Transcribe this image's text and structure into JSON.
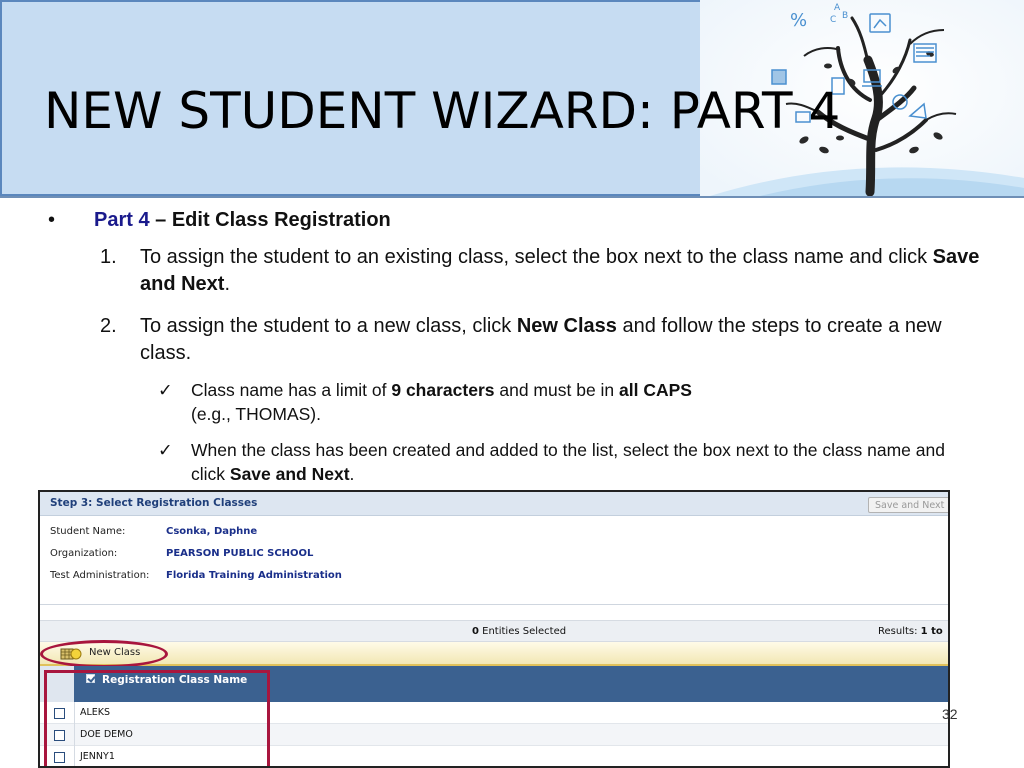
{
  "slide": {
    "title": "NEW STUDENT WIZARD: PART 4",
    "page_number": "32",
    "bullet": {
      "marker": "•",
      "part": "Part 4",
      "rest": " – Edit Class Registration"
    },
    "items": [
      {
        "num": "1.",
        "pre": "To assign the student to an existing class, select the box next to the class name and click ",
        "bold": "Save and Next",
        "post": "."
      },
      {
        "num": "2.",
        "pre": "To assign the student to a new class, click ",
        "bold": "New Class",
        "post": " and follow the steps to create a new class."
      }
    ],
    "checks": [
      {
        "mark": "✓",
        "p1": "Class name has a limit of ",
        "b1": "9 characters",
        "p2": " and must be in ",
        "b2": "all CAPS",
        "p3": " (e.g., THOMAS)."
      },
      {
        "mark": "✓",
        "p1": "When the class has been created and added to the list, select the box next to the class name and click ",
        "b1": "Save and Next",
        "p2": "."
      }
    ]
  },
  "app": {
    "step_title": "Step 3: Select Registration Classes",
    "save_next_label": "Save and Next",
    "fields": [
      {
        "label": "Student Name:",
        "value": "Csonka,  Daphne"
      },
      {
        "label": "Organization:",
        "value": "PEARSON PUBLIC SCHOOL"
      },
      {
        "label": "Test Administration:",
        "value": "Florida Training Administration"
      }
    ],
    "entities_count": "0",
    "entities_label": " Entities Selected",
    "results_label": "Results: ",
    "results_value": "1 to",
    "new_class_label": "New Class",
    "column_header": "Registration Class Name",
    "rows": [
      "ALEKS",
      "DOE DEMO",
      "JENNY1"
    ]
  },
  "colors": {
    "header_bg": "#c6dcf2",
    "header_border": "#5b87bd",
    "part_label": "#1a1a8c",
    "grid_header": "#3b6190",
    "highlight": "#a8163e"
  },
  "icons": [
    "tree-illustration",
    "bullet-dot",
    "check-mark-icon",
    "new-class-icon",
    "header-checkbox-icon",
    "row-checkbox-icon"
  ]
}
